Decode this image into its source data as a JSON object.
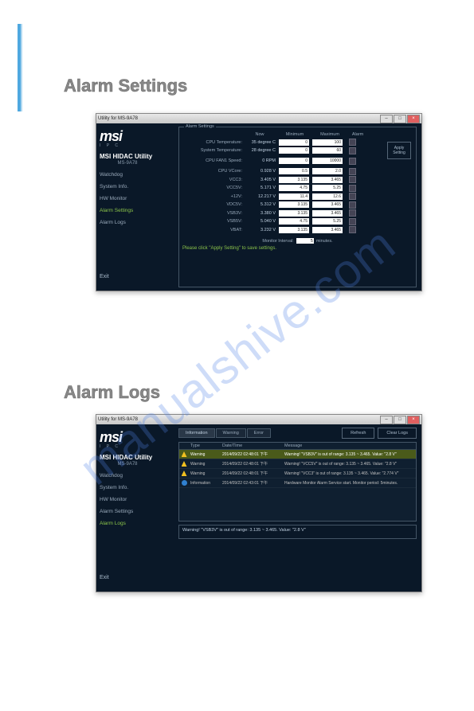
{
  "watermark": "manualshive.com",
  "sections": {
    "settings_title": "Alarm Settings",
    "logs_title": "Alarm Logs"
  },
  "window": {
    "title": "Utility for MS-9A78",
    "logo": "msi",
    "logo_sub": "I P C",
    "brand": "MSI HIDAC Utility",
    "model": "MS-9A78",
    "exit": "Exit"
  },
  "nav": [
    {
      "label": "Watchdog"
    },
    {
      "label": "System Info."
    },
    {
      "label": "HW Monitor"
    },
    {
      "label": "Alarm Settings"
    },
    {
      "label": "Alarm Logs"
    }
  ],
  "settings": {
    "panel_label": "Alarm Settings",
    "headers": {
      "now": "Now",
      "min": "Minimum",
      "max": "Maximum",
      "alarm": "Alarm"
    },
    "apply_label": "Apply Setting",
    "rows": [
      {
        "label": "CPU Temperature:",
        "now": "35 degree C",
        "min": "0",
        "max": "100"
      },
      {
        "label": "System Temperature:",
        "now": "28 degree C",
        "min": "0",
        "max": "60"
      }
    ],
    "fan": {
      "label": "CPU FAN1 Speed:",
      "now": "0 RPM",
      "min": "0",
      "max": "10000"
    },
    "volts": [
      {
        "label": "CPU VCore:",
        "now": "0.928 V",
        "min": "0.5",
        "max": "2.0"
      },
      {
        "label": "VCC3:",
        "now": "3.405 V",
        "min": "3.135",
        "max": "3.465"
      },
      {
        "label": "VCC5V:",
        "now": "5.171 V",
        "min": "4.75",
        "max": "5.25"
      },
      {
        "label": "+12V:",
        "now": "12.217 V",
        "min": "11.4",
        "max": "12.6"
      },
      {
        "label": "VDC5V:",
        "now": "5.312 V",
        "min": "3.135",
        "max": "3.465"
      },
      {
        "label": "VSB3V:",
        "now": "3.380 V",
        "min": "3.135",
        "max": "3.465"
      },
      {
        "label": "VSB5V:",
        "now": "5.040 V",
        "min": "4.75",
        "max": "5.25"
      },
      {
        "label": "VBAT:",
        "now": "3.232 V",
        "min": "3.135",
        "max": "3.465"
      }
    ],
    "interval": {
      "label": "Monitor Interval:",
      "value": "5",
      "unit": "minutes."
    },
    "hint": "Please click \"Apply Setting\" to save settings."
  },
  "logs": {
    "tabs": [
      {
        "label": "Information"
      },
      {
        "label": "Warning"
      },
      {
        "label": "Error"
      }
    ],
    "refresh": "Refresh",
    "clear": "Clear Logs",
    "headers": {
      "type": "Type",
      "datetime": "Date/Time",
      "message": "Message"
    },
    "rows": [
      {
        "type": "Warning",
        "dt": "2014/09/22 02:48:01 下午",
        "msg": "Warning! \"VSB3V\" is out of range: 3.135 ~ 3.465. Value: \"2.8 V\"",
        "hl": true,
        "icon": "warn"
      },
      {
        "type": "Warning",
        "dt": "2014/09/22 02:48:01 下午",
        "msg": "Warning! \"VCC5V\" is out of range: 3.135 ~ 3.465. Value: \"2.8 V\"",
        "icon": "warn"
      },
      {
        "type": "Warning",
        "dt": "2014/09/22 02:48:01 下午",
        "msg": "Warning! \"VCC3\" is out of range: 3.135 ~ 3.465. Value: \"2.774 V\"",
        "icon": "warn"
      },
      {
        "type": "Information",
        "dt": "2014/09/22 02:43:01 下午",
        "msg": "Hardware Monitor Alarm Service start. Monitor period: 5minutes.",
        "icon": "info"
      }
    ],
    "detail": "Warning! \"VSB3V\" is out of range: 3.135 ~ 3.465. Value: \"2.8 V\""
  }
}
